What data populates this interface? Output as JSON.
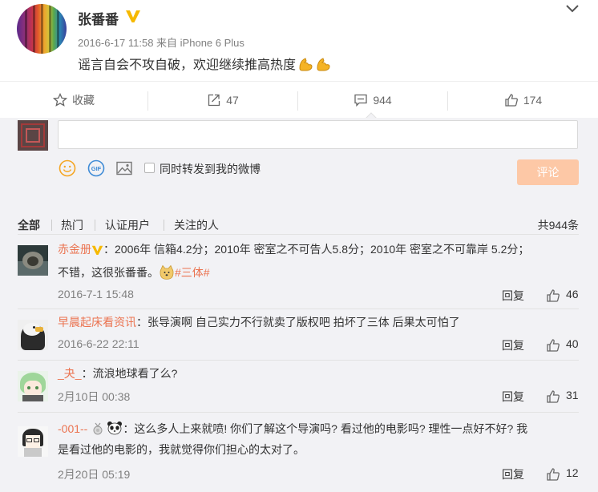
{
  "post": {
    "author": "张番番",
    "meta": "2016-6-17 11:58 来自 iPhone 6 Plus",
    "text": "谣言自会不攻自破，欢迎继续推高热度"
  },
  "actions": {
    "favorite_label": "收藏",
    "repost_count": "47",
    "comment_count": "944",
    "like_count": "174"
  },
  "composer": {
    "repost_label": "同时转发到我的微博",
    "submit_label": "评论"
  },
  "filters": {
    "tabs": [
      "全部",
      "热门",
      "认证用户",
      "关注的人"
    ],
    "total": "共944条"
  },
  "comments": [
    {
      "user": "赤金册",
      "line1": "：2006年 信箱4.2分；2010年 密室之不可告人5.8分；2010年 密室之不可靠岸 5.2分；",
      "line2": "不错，这很张番番。",
      "hashtag": "#三体#",
      "time": "2016-7-1 15:48",
      "reply": "回复",
      "likes": "46"
    },
    {
      "user": "早晨起床看资讯",
      "text": "：张导演啊 自己实力不行就卖了版权吧 拍坏了三体 后果太可怕了",
      "time": "2016-6-22 22:11",
      "reply": "回复",
      "likes": "40"
    },
    {
      "user": "_夬_",
      "text": "：流浪地球看了么?",
      "time": "2月10日 00:38",
      "reply": "回复",
      "likes": "31"
    },
    {
      "user": "-001--",
      "line1": "：这么多人上来就喷! 你们了解这个导演吗? 看过他的电影吗? 理性一点好不好? 我",
      "line2": "是看过他的电影的，我就觉得你们担心的太对了。",
      "time": "2月20日 05:19",
      "reply": "回复",
      "likes": "12"
    }
  ],
  "colors": {
    "accent": "#eb7350",
    "submit_bg": "#fdc8a6",
    "panel_bg": "#f2f2f5",
    "verified_gold": "#f6b900",
    "icon_blue": "#3e8bd6"
  }
}
